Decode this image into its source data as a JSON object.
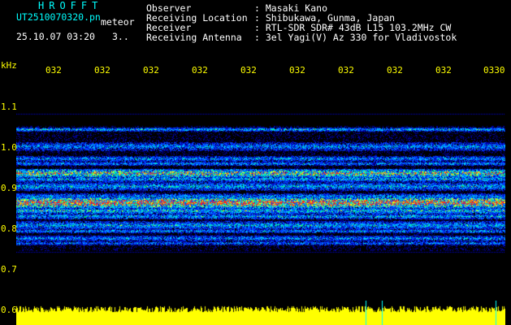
{
  "app": {
    "title": "HROFFT",
    "filename": "UT2510070320.pn",
    "mode": "meteor",
    "datetime": "25.10.07 03:20",
    "counter": "3.."
  },
  "info": {
    "rows": [
      {
        "label": "Observer",
        "value": ": Masaki Kano"
      },
      {
        "label": "Receiving Location",
        "value": ": Shibukawa, Gunma, Japan"
      },
      {
        "label": "Receiver",
        "value": ": RTL-SDR SDR# 43dB L15 103.2MHz CW"
      },
      {
        "label": "Receiving Antenna",
        "value": ": 3el Yagi(V) Az 330 for Vladivostok"
      }
    ]
  },
  "axis": {
    "unit": "kHz",
    "y_ticks": [
      "1.1",
      "1.0",
      "0.9",
      "0.8",
      "0.7",
      "0.6"
    ],
    "x_ticks": [
      "032",
      "032",
      "032",
      "032",
      "032",
      "032",
      "032",
      "032",
      "032",
      "0330"
    ]
  },
  "colors": {
    "text_cyan": "#00ffff",
    "text_white": "#ffffff",
    "axis_yellow": "#ffff00",
    "background": "#000000"
  }
}
